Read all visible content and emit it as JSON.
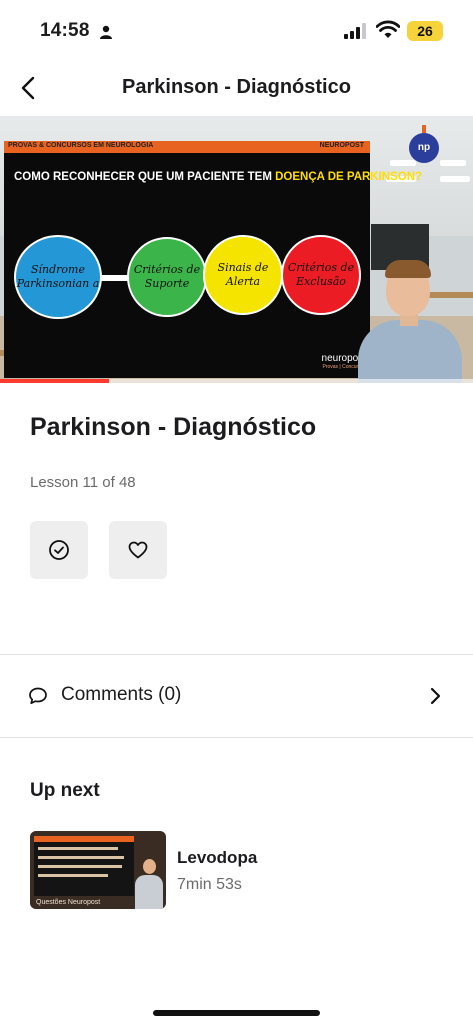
{
  "status_bar": {
    "time": "14:58",
    "battery_level": "26",
    "icons": [
      "person-icon",
      "cellular-signal-icon",
      "wifi-icon",
      "battery-icon"
    ]
  },
  "nav": {
    "title": "Parkinson - Diagnóstico",
    "back_icon": "chevron-left-icon"
  },
  "video": {
    "slide_header_left": "PROVAS & CONCURSOS EM NEUROLOGIA",
    "slide_header_right": "NEUROPOST",
    "slide_question_prefix": "COMO RECONHECER QUE UM PACIENTE TEM ",
    "slide_question_highlight": "DOENÇA DE PARKINSON?",
    "circles": [
      {
        "label": "Síndrome Parkinsonian a",
        "color": "#2497d6"
      },
      {
        "label": "Critérios de Suporte",
        "color": "#3bb54a"
      },
      {
        "label": "Sinais de Alerta",
        "color": "#f4e400"
      },
      {
        "label": "Critérios de Exclusão",
        "color": "#ec1c24"
      }
    ],
    "slide_logo": "neuropost",
    "slide_logo_sub": "Provas | Concursos",
    "channel_badge": "np",
    "progress_fraction": 0.23,
    "progress_color": "#ff3b30"
  },
  "lesson": {
    "title": "Parkinson - Diagnóstico",
    "count": "Lesson 11 of 48",
    "complete_icon": "check-circle-icon",
    "favorite_icon": "heart-icon"
  },
  "comments": {
    "label": "Comments (0)",
    "icon": "speech-bubble-icon",
    "chevron": "chevron-right-icon"
  },
  "up_next": {
    "heading": "Up next",
    "items": [
      {
        "title": "Levodopa",
        "duration": "7min 53s",
        "thumb_caption": "Questões Neuropost"
      }
    ]
  }
}
